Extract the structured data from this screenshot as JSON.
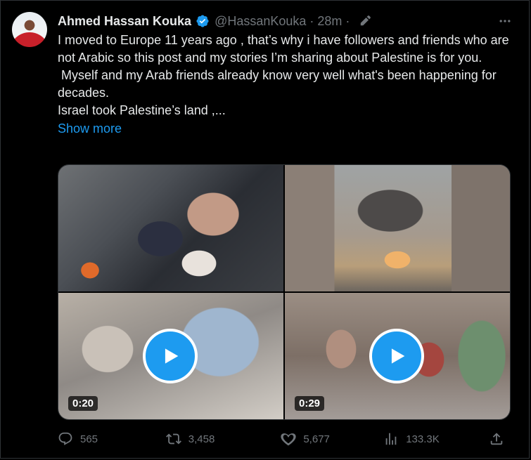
{
  "author": {
    "name": "Ahmed Hassan Kouka",
    "handle": "@HassanKouka",
    "separator": "·",
    "time": "28m",
    "separator2": "·"
  },
  "tweet": {
    "paragraphs": [
      "I moved to Europe 11 years ago , that’s why i have followers and friends who are not Arabic so this post and my stories I’m sharing about Palestine is for you.",
      " Myself and my Arab friends already know very well what's been happening for decades.",
      "Israel took Palestine’s land ,..."
    ],
    "show_more": "Show more"
  },
  "media": {
    "videos": [
      {
        "duration": "0:20"
      },
      {
        "duration": "0:29"
      }
    ]
  },
  "actions": {
    "replies": "565",
    "reposts": "3,458",
    "likes": "5,677",
    "views": "133.3K"
  },
  "icons": {
    "verified": "verified-badge-icon",
    "edit": "edit-pencil-icon",
    "more": "more-options-icon",
    "reply": "reply-icon",
    "repost": "repost-icon",
    "like": "heart-icon",
    "views": "views-icon",
    "share": "share-icon",
    "play": "play-icon"
  },
  "colors": {
    "background": "#000000",
    "text": "#e7e9ea",
    "muted": "#71767b",
    "accent": "#1d9bf0"
  }
}
